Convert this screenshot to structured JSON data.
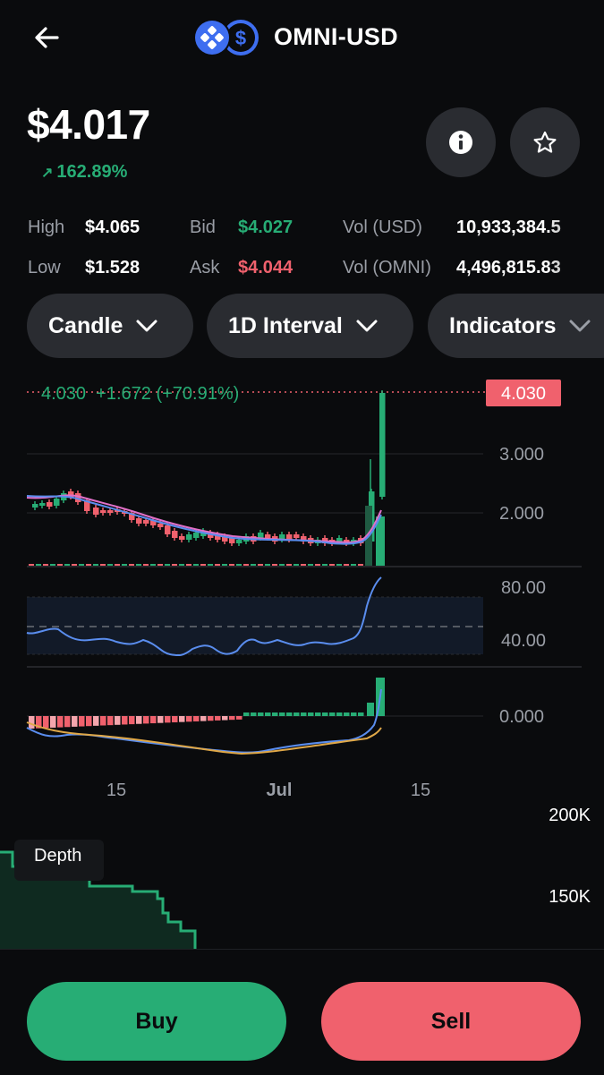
{
  "header": {
    "title": "OMNI-USD",
    "back_icon": "arrow-left-icon",
    "coin_icon": "omni-logo-icon",
    "quote_icon": "usd-coin-icon"
  },
  "price": {
    "value": "$4.017",
    "change_arrow": "↗",
    "change": "162.89%"
  },
  "actions": {
    "info_icon": "info-icon",
    "star_icon": "star-icon"
  },
  "stats": {
    "high_label": "High",
    "high_value": "$4.065",
    "low_label": "Low",
    "low_value": "$1.528",
    "bid_label": "Bid",
    "bid_value": "$4.027",
    "ask_label": "Ask",
    "ask_value": "$4.044",
    "vol_usd_label": "Vol (USD)",
    "vol_usd_value": "10,933,384.5",
    "vol_omni_label": "Vol (OMNI)",
    "vol_omni_value": "4,496,815.83"
  },
  "controls": {
    "chart_type": "Candle",
    "interval": "1D Interval",
    "indicators": "Indicators"
  },
  "chart": {
    "last_info": "4.030  +1.672 (+70.91%)",
    "last_price_tag": "4.030",
    "price_ticks": [
      "3.000",
      "2.000"
    ],
    "rsi_ticks": [
      "80.00",
      "40.00"
    ],
    "macd_ticks": [
      "0.000"
    ],
    "x_ticks": [
      "15",
      "Jul",
      "15"
    ]
  },
  "depth": {
    "label": "Depth",
    "ticks": [
      "200K",
      "150K"
    ]
  },
  "trade": {
    "buy_label": "Buy",
    "sell_label": "Sell"
  },
  "colors": {
    "green": "#27ad75",
    "red": "#f0616d",
    "panel": "#2a2c31",
    "background": "#0a0b0d"
  }
}
